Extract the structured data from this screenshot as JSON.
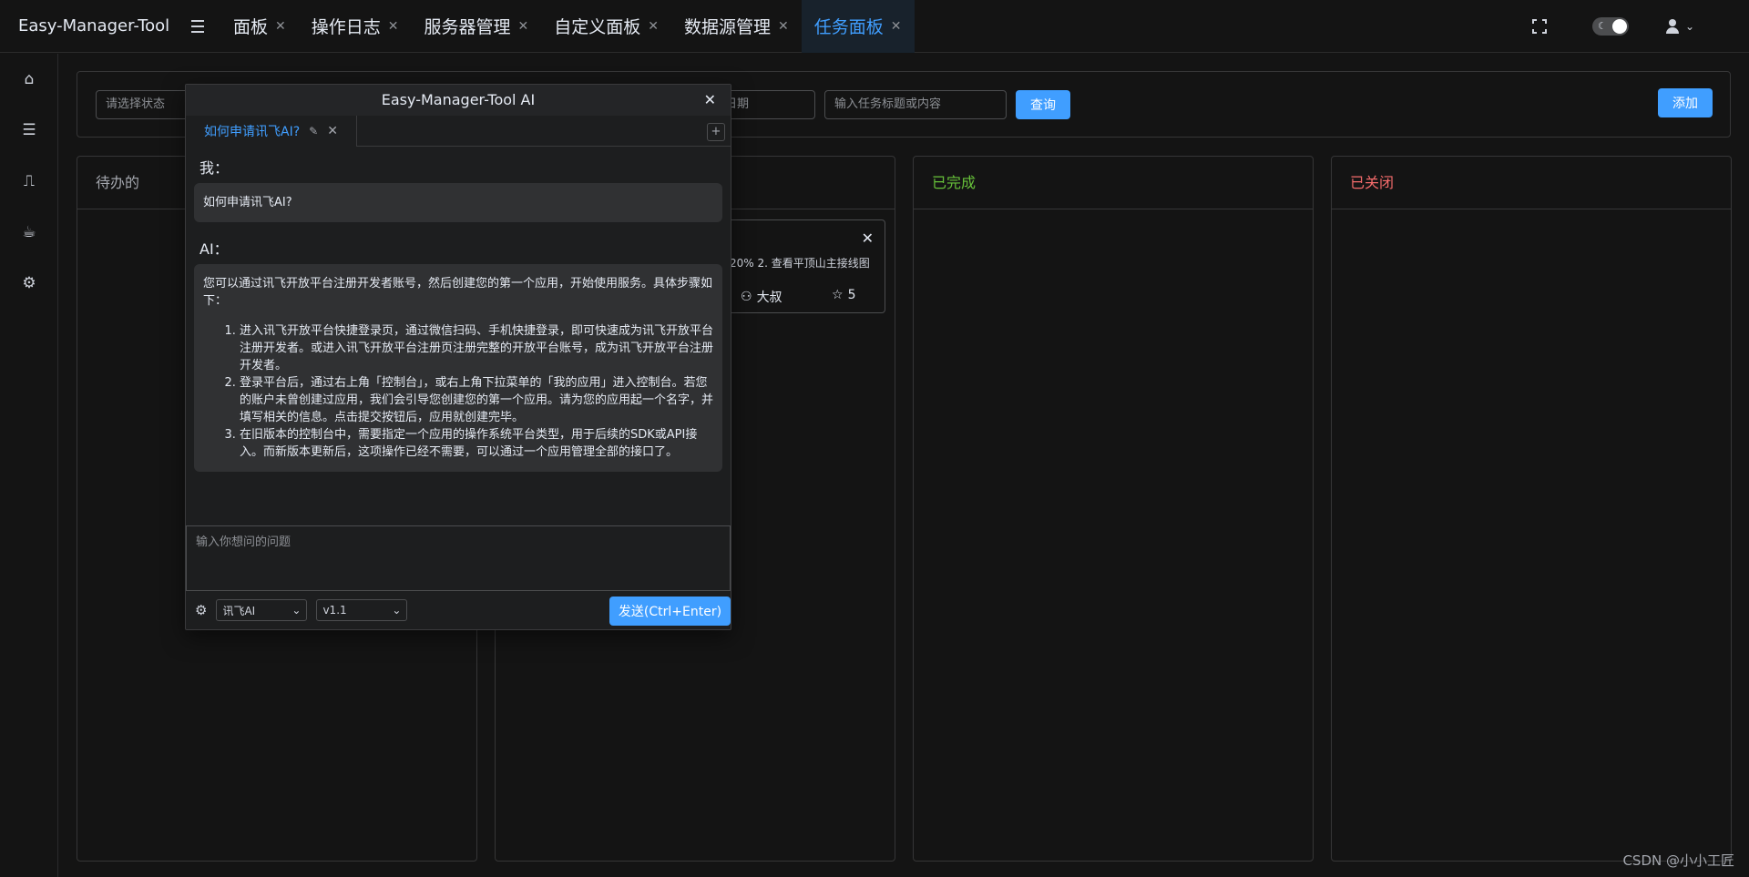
{
  "app": {
    "title": "Easy-Manager-Tool"
  },
  "tabs": [
    {
      "label": "面板"
    },
    {
      "label": "操作日志"
    },
    {
      "label": "服务器管理"
    },
    {
      "label": "自定义面板"
    },
    {
      "label": "数据源管理"
    },
    {
      "label": "任务面板",
      "active": true
    }
  ],
  "header_icons": {
    "fullscreen": "fullscreen-icon",
    "theme": "moon-icon",
    "user": "user-icon"
  },
  "sidebar": {
    "items": [
      {
        "icon": "home-icon",
        "glyph": "⌂"
      },
      {
        "icon": "server-icon",
        "glyph": "☰"
      },
      {
        "icon": "monitor-icon",
        "glyph": "⎍"
      },
      {
        "icon": "coffee-icon",
        "glyph": "☕"
      },
      {
        "icon": "gear-icon",
        "glyph": "⚙"
      }
    ]
  },
  "filters": {
    "status_placeholder": "请选择状态",
    "date_placeholder": "日期",
    "keyword_placeholder": "输入任务标题或内容",
    "query_label": "查询",
    "add_label": "添加"
  },
  "columns": {
    "todo": "待办的",
    "done": "已完成",
    "closed": "已关闭"
  },
  "task_card": {
    "content_snippet": "20% 2. 查看平顶山主接线图",
    "owner": "大叔",
    "stars": "5"
  },
  "ai_dialog": {
    "title": "Easy-Manager-Tool AI",
    "tab_label": "如何申请讯飞AI?",
    "user_label": "我：",
    "user_message": "如何申请讯飞AI?",
    "ai_label": "AI：",
    "ai_intro": "您可以通过讯飞开放平台注册开发者账号，然后创建您的第一个应用，开始使用服务。具体步骤如下：",
    "ai_steps": [
      "进入讯飞开放平台快捷登录页，通过微信扫码、手机快捷登录，即可快速成为讯飞开放平台注册开发者。或进入讯飞开放平台注册页注册完整的开放平台账号，成为讯飞开放平台注册开发者。",
      "登录平台后，通过右上角「控制台」，或右上角下拉菜单的「我的应用」进入控制台。若您的账户未曾创建过应用，我们会引导您创建您的第一个应用。请为您的应用起一个名字，并填写相关的信息。点击提交按钮后，应用就创建完毕。",
      "在旧版本的控制台中，需要指定一个应用的操作系统平台类型，用于后续的SDK或API接入。而新版本更新后，这项操作已经不需要，可以通过一个应用管理全部的接口了。"
    ],
    "input_placeholder": "输入你想问的问题",
    "model_select": "讯飞AI",
    "version_select": "v1.1",
    "send_label": "发送(Ctrl+Enter)"
  },
  "watermark": "CSDN @小小工匠"
}
